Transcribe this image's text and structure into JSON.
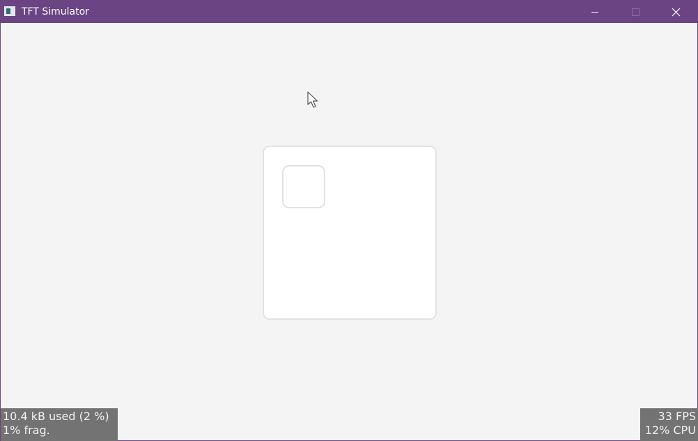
{
  "window": {
    "title": "TFT Simulator",
    "titlebar_color": "#6b4484",
    "background_color": "#f4f4f4",
    "controls": {
      "minimize": "minimize-icon",
      "maximize": "maximize-icon",
      "close": "close-icon"
    }
  },
  "monitor": {
    "memory_used": "10.4 kB used (2 %)",
    "fragmentation": "1% frag.",
    "fps": "33 FPS",
    "cpu": "12% CPU"
  }
}
